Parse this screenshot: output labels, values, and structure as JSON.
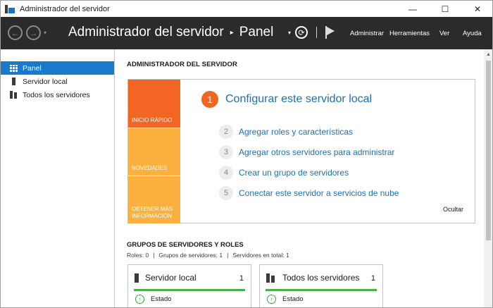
{
  "window": {
    "title": "Administrador del servidor",
    "controls": {
      "minimize": "—",
      "maximize": "☐",
      "close": "✕"
    }
  },
  "header": {
    "back_icon": "←",
    "forward_icon": "→",
    "history_dropdown": "▾",
    "breadcrumb": {
      "root": "Administrador del servidor",
      "separator": "▸",
      "current": "Panel"
    },
    "actions_dropdown": "▾",
    "refresh_icon": "⟳",
    "menu": [
      "Administrar",
      "Herramientas",
      "Ver",
      "Ayuda"
    ]
  },
  "sidebar": {
    "items": [
      {
        "label": "Panel",
        "icon": "dashboard-grid-icon",
        "active": true
      },
      {
        "label": "Servidor local",
        "icon": "server-icon",
        "active": false
      },
      {
        "label": "Todos los servidores",
        "icon": "servers-icon",
        "active": false
      }
    ]
  },
  "main": {
    "section_title": "ADMINISTRADOR DEL SERVIDOR",
    "quick_start": {
      "tiles": [
        "INICIO RÁPIDO",
        "NOVEDADES",
        "OBTENER MÁS INFORMACIÓN"
      ],
      "main_step": {
        "number": "1",
        "label": "Configurar este servidor local"
      },
      "steps": [
        {
          "number": "2",
          "label": "Agregar roles y características"
        },
        {
          "number": "3",
          "label": "Agregar otros servidores para administrar"
        },
        {
          "number": "4",
          "label": "Crear un grupo de servidores"
        },
        {
          "number": "5",
          "label": "Conectar este servidor a servicios de nube"
        }
      ],
      "hide_label": "Ocultar"
    },
    "groups": {
      "title": "GRUPOS DE SERVIDORES Y ROLES",
      "stats": [
        "Roles: 0",
        "|",
        "Grupos de servidores: 1",
        "|",
        "Servidores en total: 1"
      ],
      "cards": [
        {
          "name": "Servidor local",
          "count": "1",
          "status": "Estado"
        },
        {
          "name": "Todos los servidores",
          "count": "1",
          "status": "Estado"
        }
      ]
    }
  },
  "colors": {
    "header_bg": "#2b2b2b",
    "sidebar_active": "#1979ca",
    "quick_start_orange": "#f26522",
    "tile_yellow": "#fbb040",
    "link_blue": "#1f6fb5",
    "status_green": "#47b247"
  }
}
